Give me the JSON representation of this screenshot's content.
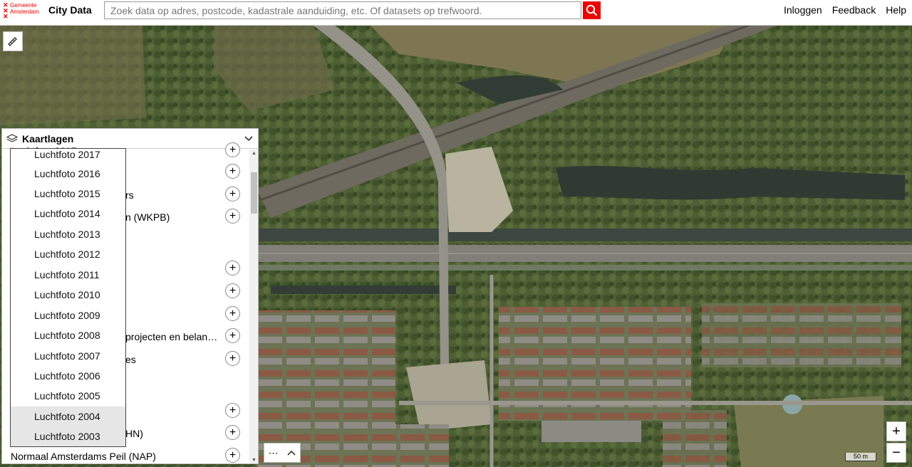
{
  "header": {
    "logo_text": [
      "Gemeente",
      "Amsterdam"
    ],
    "brand": "City Data",
    "search_placeholder": "Zoek data op adres, postcode, kadastrale aanduiding, etc. Of datasets op trefwoord.",
    "nav": [
      "Inloggen",
      "Feedback",
      "Help"
    ]
  },
  "colors": {
    "accent": "#ec0000",
    "map_bg": "#5e6a43"
  },
  "panel": {
    "title": "Kaartlagen",
    "rows": [
      {
        "label": "Luchtfoto 2017 … ",
        "visible_suffix": "",
        "has_add": true
      },
      {
        "label": "",
        "has_add": true
      },
      {
        "label": "rs",
        "has_add": true
      },
      {
        "label": "n (WKPB)",
        "has_add": true
      },
      {
        "label": "",
        "has_add": false
      },
      {
        "label": "",
        "has_add": true
      },
      {
        "label": "",
        "has_add": true
      },
      {
        "label": "",
        "has_add": true
      },
      {
        "label": "projecten en belan…",
        "has_add": true
      },
      {
        "label": "es",
        "has_add": true
      },
      {
        "label": "",
        "has_add": false
      },
      {
        "label": "",
        "has_add": true
      },
      {
        "label": "HN)",
        "has_add": true
      },
      {
        "label": "Normaal Amsterdams Peil (NAP)",
        "has_add": true
      }
    ]
  },
  "dropdown": {
    "items": [
      "Luchtfoto 2017",
      "Luchtfoto 2016",
      "Luchtfoto 2015",
      "Luchtfoto 2014",
      "Luchtfoto 2013",
      "Luchtfoto 2012",
      "Luchtfoto 2011",
      "Luchtfoto 2010",
      "Luchtfoto 2009",
      "Luchtfoto 2008",
      "Luchtfoto 2007",
      "Luchtfoto 2006",
      "Luchtfoto 2005",
      "Luchtfoto 2004",
      "Luchtfoto 2003"
    ]
  },
  "map": {
    "scale_label": "50 m"
  }
}
